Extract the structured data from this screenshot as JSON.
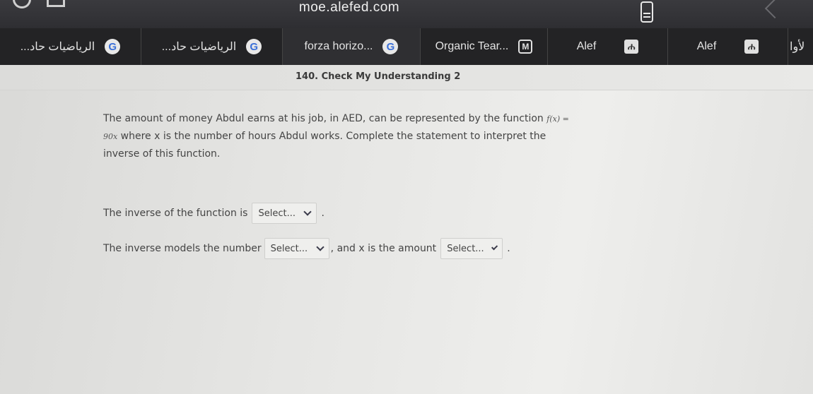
{
  "browser": {
    "url": "moe.alefed.com"
  },
  "tabs": [
    {
      "label": "...الرياضيات حاد",
      "icon": "google-icon",
      "icon_glyph": "G"
    },
    {
      "label": "...الرياضيات حاد",
      "icon": "google-icon",
      "icon_glyph": "G"
    },
    {
      "label": "forza horizo...",
      "icon": "google-icon",
      "icon_glyph": "G"
    },
    {
      "label": "Organic Tear...",
      "icon": "m-app-icon",
      "icon_glyph": "M"
    },
    {
      "label": "Alef",
      "icon": "alef-icon",
      "icon_glyph": "ሐ"
    },
    {
      "label": "Alef",
      "icon": "alef-icon",
      "icon_glyph": "ሐ"
    },
    {
      "label": "لأوا"
    }
  ],
  "page": {
    "title": "140. Check My Understanding 2",
    "question_part1": "The amount of money Abdul earns at his job, in AED, can be represented by the function",
    "function_text": "f(x) = 90x",
    "question_part2": "where x is the number of hours Abdul works. Complete the statement to interpret the inverse of this function.",
    "line1_prefix": "The inverse of the function is",
    "line1_suffix": ".",
    "line2_prefix": "The inverse models the number",
    "line2_middle": ", and x is the amount",
    "line2_suffix": ".",
    "select_placeholder": "Select..."
  }
}
